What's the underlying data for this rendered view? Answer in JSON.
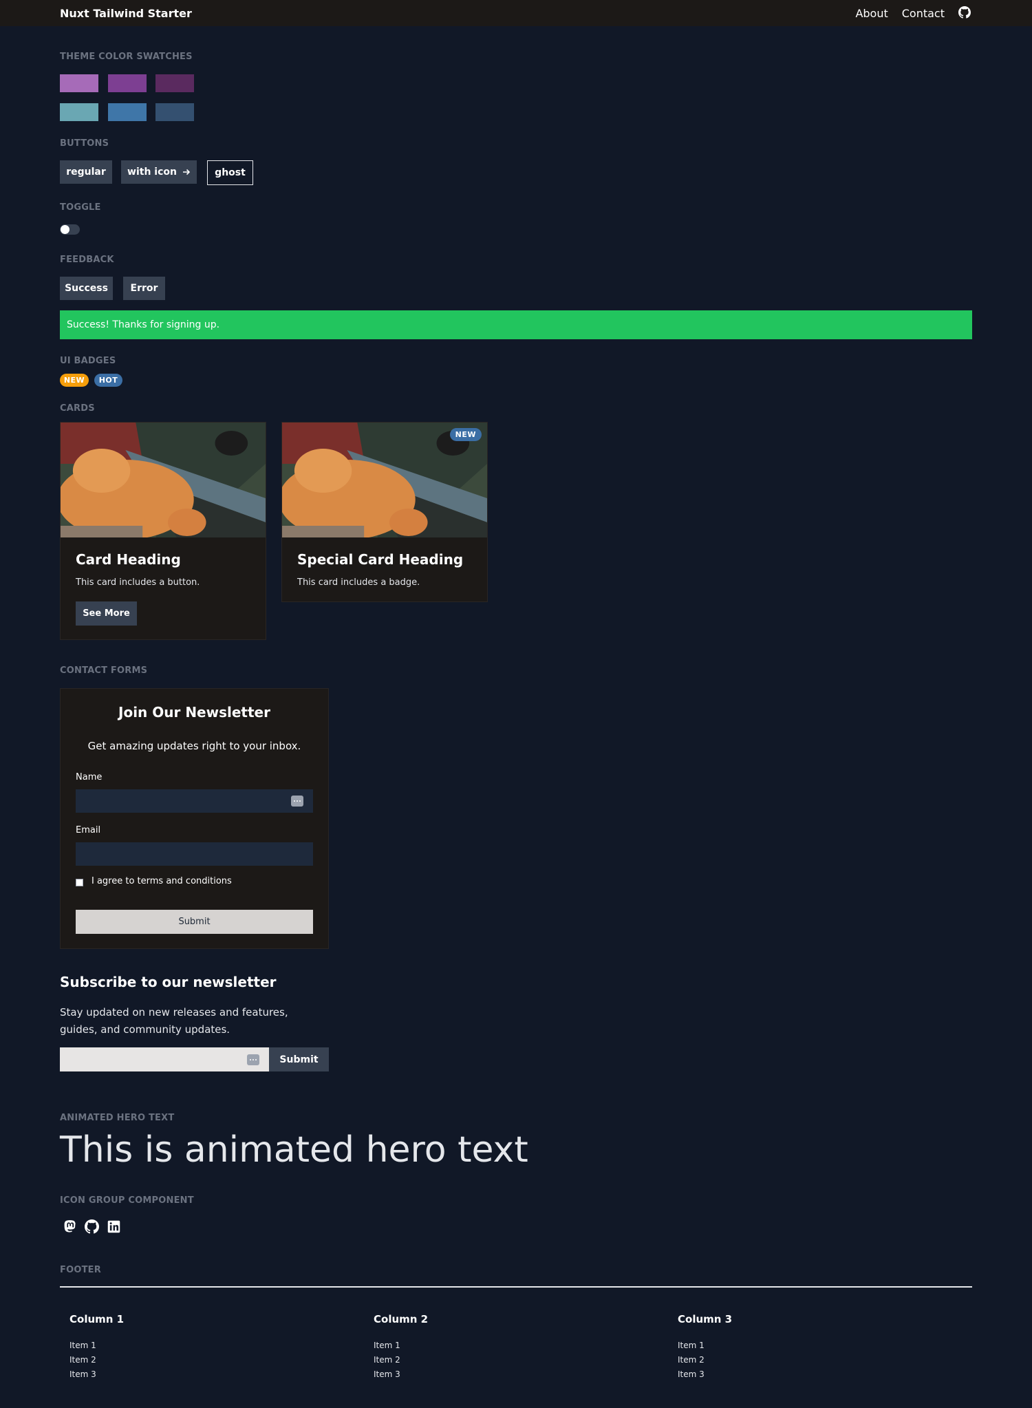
{
  "header": {
    "brand": "Nuxt Tailwind Starter",
    "nav": [
      "About",
      "Contact"
    ],
    "github_icon": "github-icon"
  },
  "sections": {
    "swatches": "THEME COLOR SWATCHES",
    "buttons": "BUTTONS",
    "toggle": "TOGGLE",
    "feedback": "FEEDBACK",
    "badges": "UI BADGES",
    "cards": "CARDS",
    "contact_forms": "CONTACT FORMS",
    "animated_hero": "ANIMATED HERO TEXT",
    "icon_group": "ICON GROUP COMPONENT",
    "footer": "FOOTER"
  },
  "swatches": {
    "row1": [
      "#a66bb8",
      "#7d3f92",
      "#5a2a5f"
    ],
    "row2": [
      "#6aa7b3",
      "#3f76a8",
      "#345070"
    ]
  },
  "buttons": {
    "regular": "regular",
    "with_icon": "with icon",
    "with_icon_icon": "arrow-right-icon",
    "ghost": "ghost"
  },
  "toggle": {
    "on": false
  },
  "feedback": {
    "success": "Success",
    "error": "Error",
    "alert": "Success! Thanks for signing up.",
    "alert_color": "#22c55e"
  },
  "badges": [
    {
      "label": "NEW",
      "color": "#f59e0b"
    },
    {
      "label": "HOT",
      "color": "#3b6ea5"
    }
  ],
  "cards": [
    {
      "title": "Card Heading",
      "text": "This card includes a button.",
      "button": "See More"
    },
    {
      "title": "Special Card Heading",
      "text": "This card includes a badge.",
      "badge": "NEW"
    }
  ],
  "newsletter_form": {
    "title": "Join Our Newsletter",
    "subtitle": "Get amazing updates right to your inbox.",
    "name_label": "Name",
    "name_value": "",
    "email_label": "Email",
    "email_value": "",
    "agree": "I agree to terms and conditions",
    "submit": "Submit"
  },
  "subscribe": {
    "title": "Subscribe to our newsletter",
    "text": "Stay updated on new releases and features, guides, and community updates.",
    "input_value": "",
    "submit": "Submit"
  },
  "hero": {
    "text": "This is animated hero text"
  },
  "icon_group": [
    "mastodon-icon",
    "github-icon",
    "linkedin-icon"
  ],
  "footer": {
    "columns": [
      {
        "title": "Column 1",
        "items": [
          "Item 1",
          "Item 2",
          "Item 3"
        ]
      },
      {
        "title": "Column 2",
        "items": [
          "Item 1",
          "Item 2",
          "Item 3"
        ]
      },
      {
        "title": "Column 3",
        "items": [
          "Item 1",
          "Item 2",
          "Item 3"
        ]
      }
    ]
  }
}
